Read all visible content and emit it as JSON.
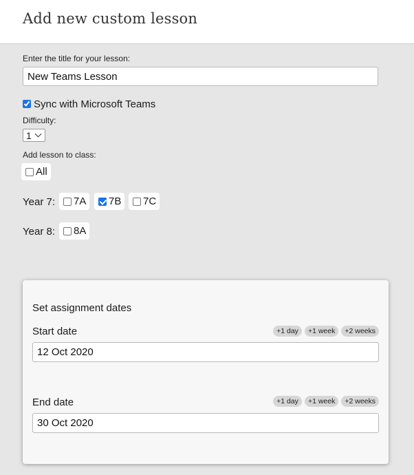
{
  "header": {
    "title": "Add new custom lesson"
  },
  "form": {
    "title_label": "Enter the title for your lesson:",
    "title_value": "New Teams Lesson",
    "sync_label": "Sync with Microsoft Teams",
    "sync_checked": true,
    "difficulty_label": "Difficulty:",
    "difficulty_value": "1",
    "class_label": "Add lesson to class:",
    "all_label": "All",
    "years": [
      {
        "label": "Year 7:",
        "classes": [
          {
            "name": "7A",
            "checked": false
          },
          {
            "name": "7B",
            "checked": true
          },
          {
            "name": "7C",
            "checked": false
          }
        ]
      },
      {
        "label": "Year 8:",
        "classes": [
          {
            "name": "8A",
            "checked": false
          }
        ]
      }
    ]
  },
  "assignment": {
    "title": "Set assignment dates",
    "start_label": "Start date",
    "start_value": "12 Oct 2020",
    "end_label": "End date",
    "end_value": "30 Oct 2020",
    "quick_buttons": [
      "+1 day",
      "+1 week",
      "+2 weeks"
    ]
  },
  "colors": {
    "checkbox_accent": "#1a73e8",
    "background": "#e6e6e6"
  }
}
